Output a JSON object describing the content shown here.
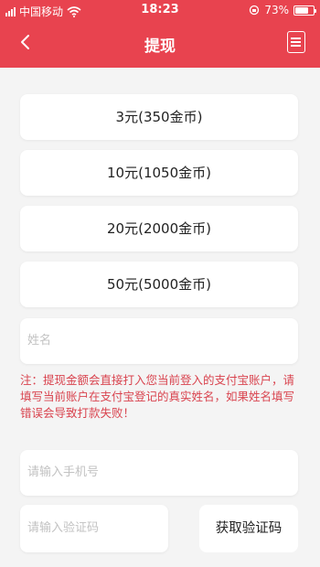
{
  "status_bar": {
    "carrier": "中国移动",
    "time": "18:23",
    "battery_percent": "73%",
    "battery_level": 0.73
  },
  "header": {
    "title": "提现",
    "back_icon": "chevron-left-icon",
    "menu_icon": "list-icon"
  },
  "amount_options": [
    {
      "label": "3元(350金币)"
    },
    {
      "label": "10元(1050金币)"
    },
    {
      "label": "20元(2000金币)"
    },
    {
      "label": "50元(5000金币)"
    }
  ],
  "form": {
    "name_placeholder": "姓名",
    "note": "注：提现金额会直接打入您当前登入的支付宝账户，请填写当前账户在支付宝登记的真实姓名，如果姓名填写错误会导致打款失败！",
    "phone_placeholder": "请输入手机号",
    "code_placeholder": "请输入验证码",
    "get_code_label": "获取验证码"
  },
  "colors": {
    "header_bg": "#e8434f",
    "note_text": "#d9444f",
    "page_bg": "#f4f4f4"
  }
}
